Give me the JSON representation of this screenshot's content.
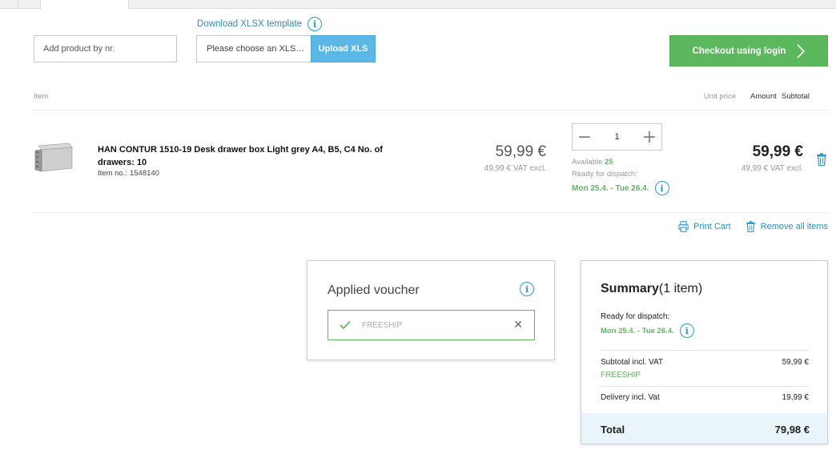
{
  "toolbar": {
    "add_product_placeholder": "Add product by nr.",
    "download_template": "Download XLSX template",
    "file_placeholder": "Please choose an XLS…",
    "upload_label": "Upload XLS",
    "checkout_label": "Checkout using login"
  },
  "table_headers": {
    "item": "Item",
    "unit_price": "Unit price",
    "amount": "Amount",
    "subtotal": "Subtotal"
  },
  "cart_item": {
    "name": "HAN CONTUR 1510-19 Desk drawer box Light grey A4, B5, C4 No. of drawers: 10",
    "item_no_label": "Item no.:",
    "item_no": "1548140",
    "unit_price": "59,99 €",
    "unit_price_excl": "49,99 € VAT excl.",
    "quantity": "1",
    "available_label": "Available",
    "available_count": "25",
    "ready_label": "Ready for dispatch:",
    "dispatch_date": "Mon 25.4. - Tue 26.4.",
    "subtotal": "59,99 €",
    "subtotal_excl": "49,99 € VAT excl."
  },
  "actions": {
    "print_cart": "Print Cart",
    "remove_all": "Remove all items"
  },
  "voucher": {
    "title": "Applied voucher",
    "code": "FREESHIP"
  },
  "summary": {
    "title": "Summary",
    "item_count": "(1 item)",
    "ready_label": "Ready for dispatch:",
    "dispatch_date": "Mon 25.4. - Tue 26.4.",
    "subtotal_label": "Subtotal incl. VAT",
    "subtotal_value": "59,99 €",
    "voucher_code": "FREESHIP",
    "delivery_label": "Delivery incl. Vat",
    "delivery_value": "19,99 €",
    "total_label": "Total",
    "total_value": "79,98 €"
  },
  "colors": {
    "accent_blue": "#2a8fbd",
    "upload_blue": "#5bb7e5",
    "checkout_green": "#5cb85c",
    "total_bg": "#eaf4fb"
  },
  "icons": [
    "info-icon",
    "chevron-right-icon",
    "minus-icon",
    "plus-icon",
    "trash-icon",
    "print-icon",
    "check-icon",
    "close-icon"
  ]
}
